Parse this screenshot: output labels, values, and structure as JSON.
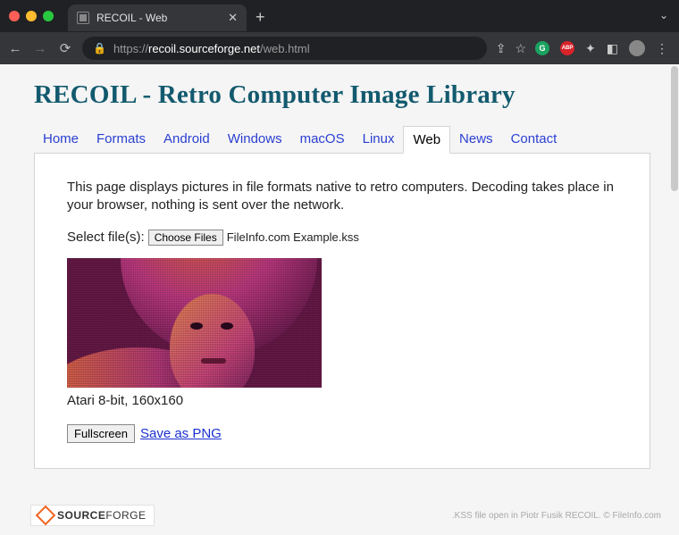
{
  "browser": {
    "tab_title": "RECOIL - Web",
    "url_scheme": "https://",
    "url_host": "recoil.sourceforge.net",
    "url_path": "/web.html"
  },
  "page": {
    "title": "RECOIL - Retro Computer Image Library",
    "nav": {
      "items": [
        {
          "label": "Home"
        },
        {
          "label": "Formats"
        },
        {
          "label": "Android"
        },
        {
          "label": "Windows"
        },
        {
          "label": "macOS"
        },
        {
          "label": "Linux"
        },
        {
          "label": "Web"
        },
        {
          "label": "News"
        },
        {
          "label": "Contact"
        }
      ],
      "active_index": 6
    },
    "intro": "This page displays pictures in file formats native to retro computers. Decoding takes place in your browser, nothing is sent over the network.",
    "select_label": "Select file(s):",
    "choose_btn": "Choose Files",
    "selected_file": "FileInfo.com Example.kss",
    "caption": "Atari 8-bit, 160x160",
    "fullscreen_btn": "Fullscreen",
    "save_link": "Save as PNG",
    "sf_source": "SOURCE",
    "sf_forge": "FORGE",
    "credit": ".KSS file open in Piotr Fusik RECOIL. © FileInfo.com"
  }
}
